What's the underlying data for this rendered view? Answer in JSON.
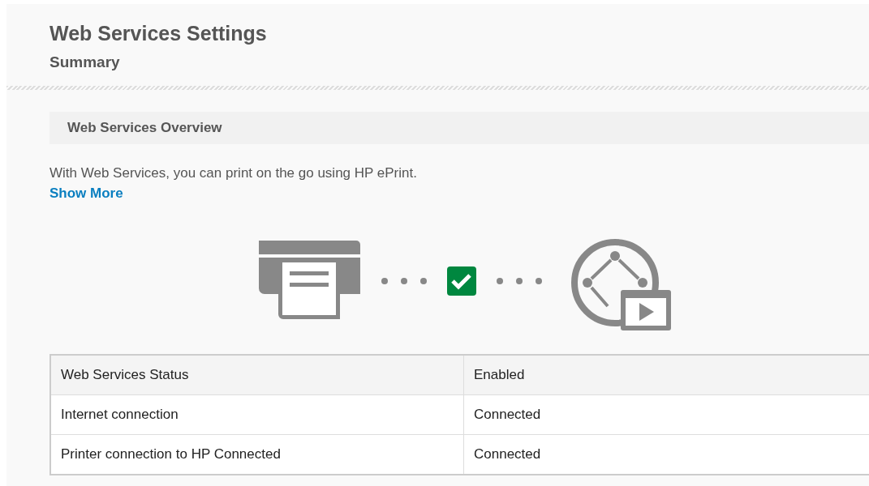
{
  "page": {
    "title": "Web Services Settings",
    "subtitle": "Summary"
  },
  "section": {
    "title": "Web Services Overview",
    "description": "With Web Services, you can print on the go using HP ePrint.",
    "link": "Show More"
  },
  "status_table": [
    {
      "label": "Web Services Status",
      "value": "Enabled"
    },
    {
      "label": "Internet connection",
      "value": "Connected"
    },
    {
      "label": "Printer connection to HP Connected",
      "value": "Connected"
    }
  ]
}
